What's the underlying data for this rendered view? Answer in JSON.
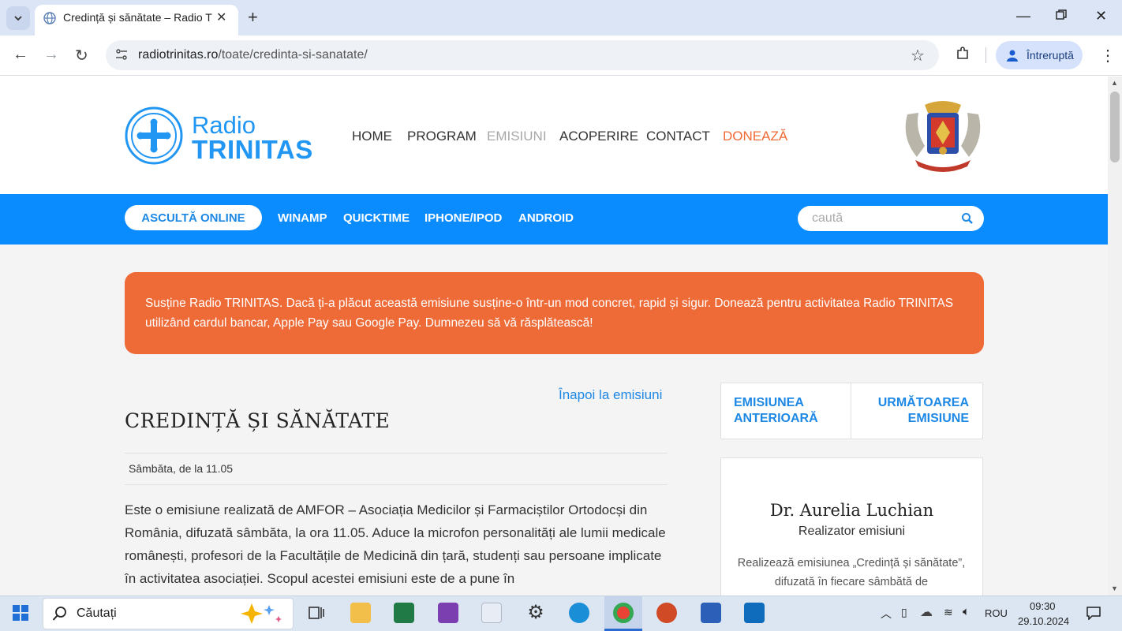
{
  "browser": {
    "tab_title": "Credință și sănătate – Radio TRI",
    "url_host": "radiotrinitas.ro",
    "url_path": "/toate/credinta-si-sanatate/",
    "profile_label": "Întreruptă"
  },
  "site": {
    "logo_line1": "Radio",
    "logo_line2": "TRINITAS",
    "nav": [
      "HOME",
      "PROGRAM",
      "EMISIUNI",
      "ACOPERIRE",
      "CONTACT",
      "DONEAZĂ"
    ],
    "listen_label": "ASCULTĂ ONLINE",
    "players": [
      "WINAMP",
      "QUICKTIME",
      "IPHONE/IPOD",
      "ANDROID"
    ],
    "search_placeholder": "caută"
  },
  "donate_banner": "Susține Radio TRINITAS. Dacă ți-a plăcut această emisiune susține-o într-un mod concret, rapid și sigur. Donează pentru activitatea Radio TRINITAS utilizând cardul bancar, Apple Pay sau Google Pay. Dumnezeu să vă răsplătească!",
  "content": {
    "back_link": "Înapoi la emisiuni",
    "title": "CREDINȚĂ ȘI SĂNĂTATE",
    "schedule": "Sâmbăta, de la 11.05",
    "description": "Este o emisiune realizată de AMFOR – Asociația Medicilor și Farmaciștilor Ortodocși din România, difuzată sâmbăta, la ora 11.05. Aduce la microfon personalități ale lumii medicale românești, profesori de la Facultățile de Medicină din țară, studenți sau persoane implicate în activitatea asociației. Scopul acestei emisiuni este de a pune în"
  },
  "sidebar": {
    "prev_line1": "EMISIUNEA",
    "prev_line2": "ANTERIOARĂ",
    "next_line1": "URMĂTOAREA",
    "next_line2": "EMISIUNE",
    "host_name": "Dr. Aurelia Luchian",
    "host_role": "Realizator emisiuni",
    "host_bio": "Realizează emisiunea „Credință și sănătate”, difuzată în fiecare sâmbătă de"
  },
  "taskbar": {
    "search_label": "Căutați",
    "language": "ROU",
    "time": "09:30",
    "date": "29.10.2024"
  },
  "colors": {
    "brand_blue": "#0a8cff",
    "link_blue": "#1e88e5",
    "donate_orange": "#ee6a37"
  }
}
